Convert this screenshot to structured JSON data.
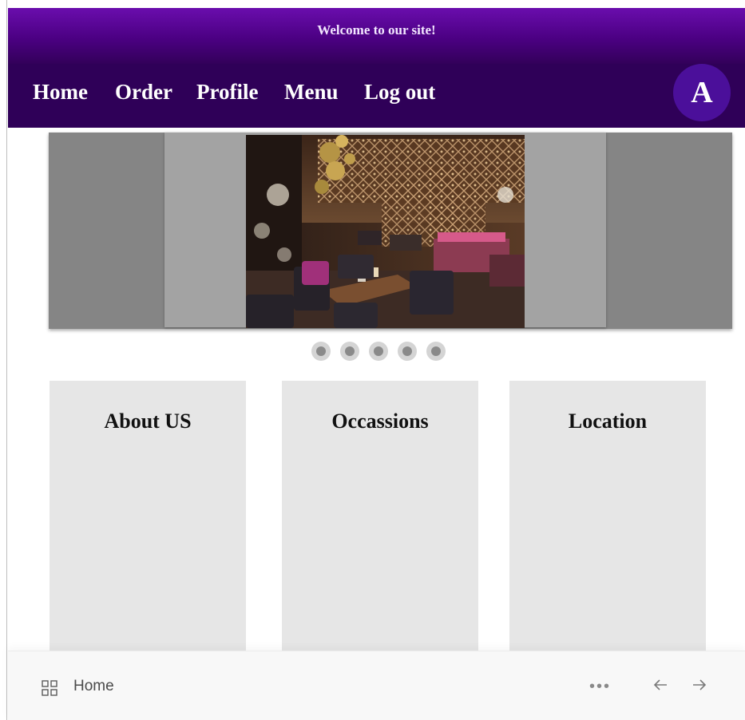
{
  "header": {
    "welcome_text": "Welcome to our site!",
    "nav": {
      "home": "Home",
      "order": "Order",
      "profile": "Profile",
      "menu": "Menu",
      "logout": "Log out"
    },
    "avatar_initial": "A"
  },
  "carousel": {
    "slide_alt": "restaurant dining interior",
    "dot_count": 5
  },
  "cards": [
    {
      "title": "About US"
    },
    {
      "title": "Occassions"
    },
    {
      "title": "Location"
    }
  ],
  "bottom_bar": {
    "label": "Home",
    "icons": [
      "grid-icon",
      "more-icon",
      "back-arrow-icon",
      "forward-arrow-icon"
    ]
  },
  "colors": {
    "header_gradient_top": "#6a0dad",
    "nav_bg": "#2f0058",
    "avatar_bg": "#4b0f9a",
    "card_bg": "#e6e6e6",
    "carousel_bg": "#858585"
  }
}
